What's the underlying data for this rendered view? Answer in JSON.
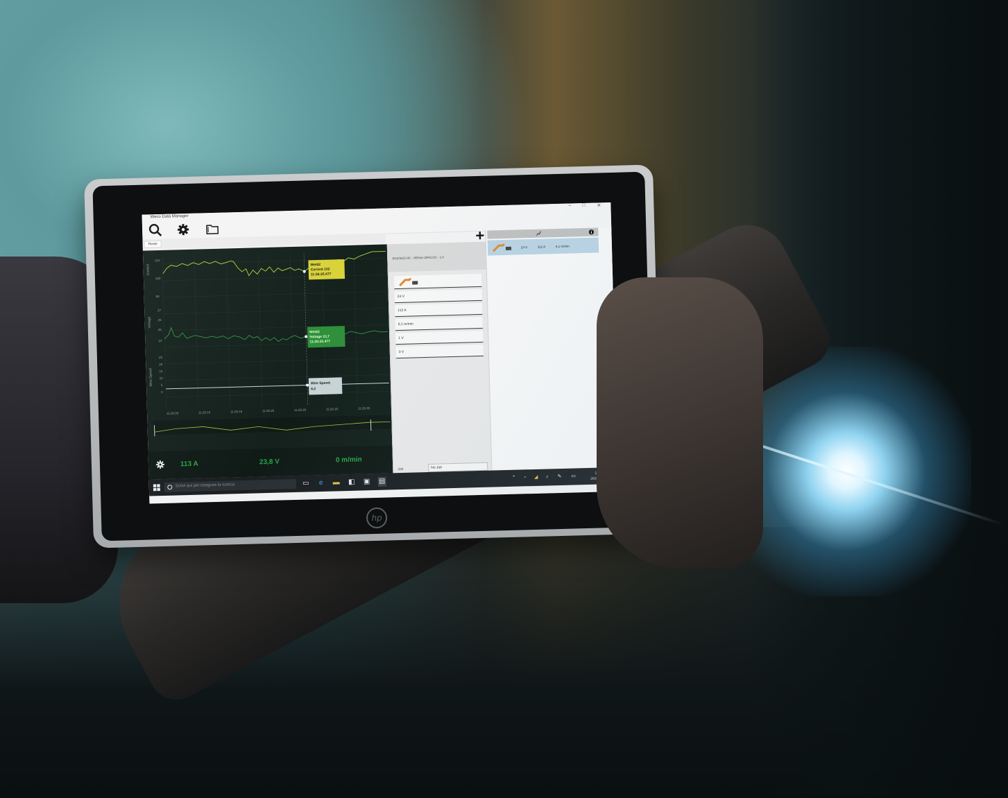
{
  "app": {
    "window_title": "Weco Data Manager",
    "window_controls": [
      "–",
      "□",
      "✕"
    ],
    "toolbar_icons": [
      "search-icon",
      "gear-icon",
      "folder-icon"
    ],
    "tab_label": "Reset",
    "add_button": "+"
  },
  "chart": {
    "y_axis_labels": [
      "Current",
      "Voltage",
      "Wire Speed"
    ],
    "current_ticks": [
      "110",
      "100",
      "90"
    ],
    "voltage_ticks": [
      "27",
      "26",
      "25",
      "24"
    ],
    "wire_ticks": [
      "25",
      "20",
      "15",
      "10",
      "5",
      "0"
    ],
    "time_ticks": [
      "11:26:05",
      "11:26:10",
      "11:26:15",
      "11:26:20",
      "11:26:25",
      "11:26:30",
      "11:26:35"
    ],
    "tooltip_current": {
      "line1": "Weld2",
      "line2": "Current 102",
      "line3": "11:26:25.477"
    },
    "tooltip_voltage": {
      "line1": "Weld2",
      "line2": "Voltage 23,7",
      "line3": "11:26:25.477"
    },
    "tooltip_wire": {
      "line1": "Wire Speed:",
      "line2": "6,2"
    }
  },
  "readouts": {
    "current": "113 A",
    "voltage": "23,8 V",
    "wire_speed": "0 m/min"
  },
  "parameters": {
    "header": "SG2/SG3 HC - 80%Ar-20%CO2 - 1,0",
    "voltage": "24  V",
    "current": "112  A",
    "wire_speed": "6,1  m/min",
    "param4": "1  V",
    "param5": "0  V",
    "job_label": "Job",
    "job_value": "No Job"
  },
  "right_panel": {
    "row_voltage": "24 V",
    "row_current": "112 A",
    "row_speed": "6,1 m/min"
  },
  "taskbar": {
    "search_placeholder": "Scrivi qui per eseguire la ricerca",
    "time": "11:31",
    "date": "26/06/2017"
  },
  "device": {
    "logo": "hp"
  },
  "colors": {
    "chart_bg": "#14211c",
    "current_line": "#9acb3c",
    "voltage_line": "#2e8b3e",
    "wire_line": "#c9d6d8",
    "tooltip_yellow": "#d8d23a",
    "tooltip_green": "#2f8f3b",
    "readout_green": "#28a745",
    "torch_orange": "#e08a2a",
    "row_blue": "#b9d3e3"
  }
}
